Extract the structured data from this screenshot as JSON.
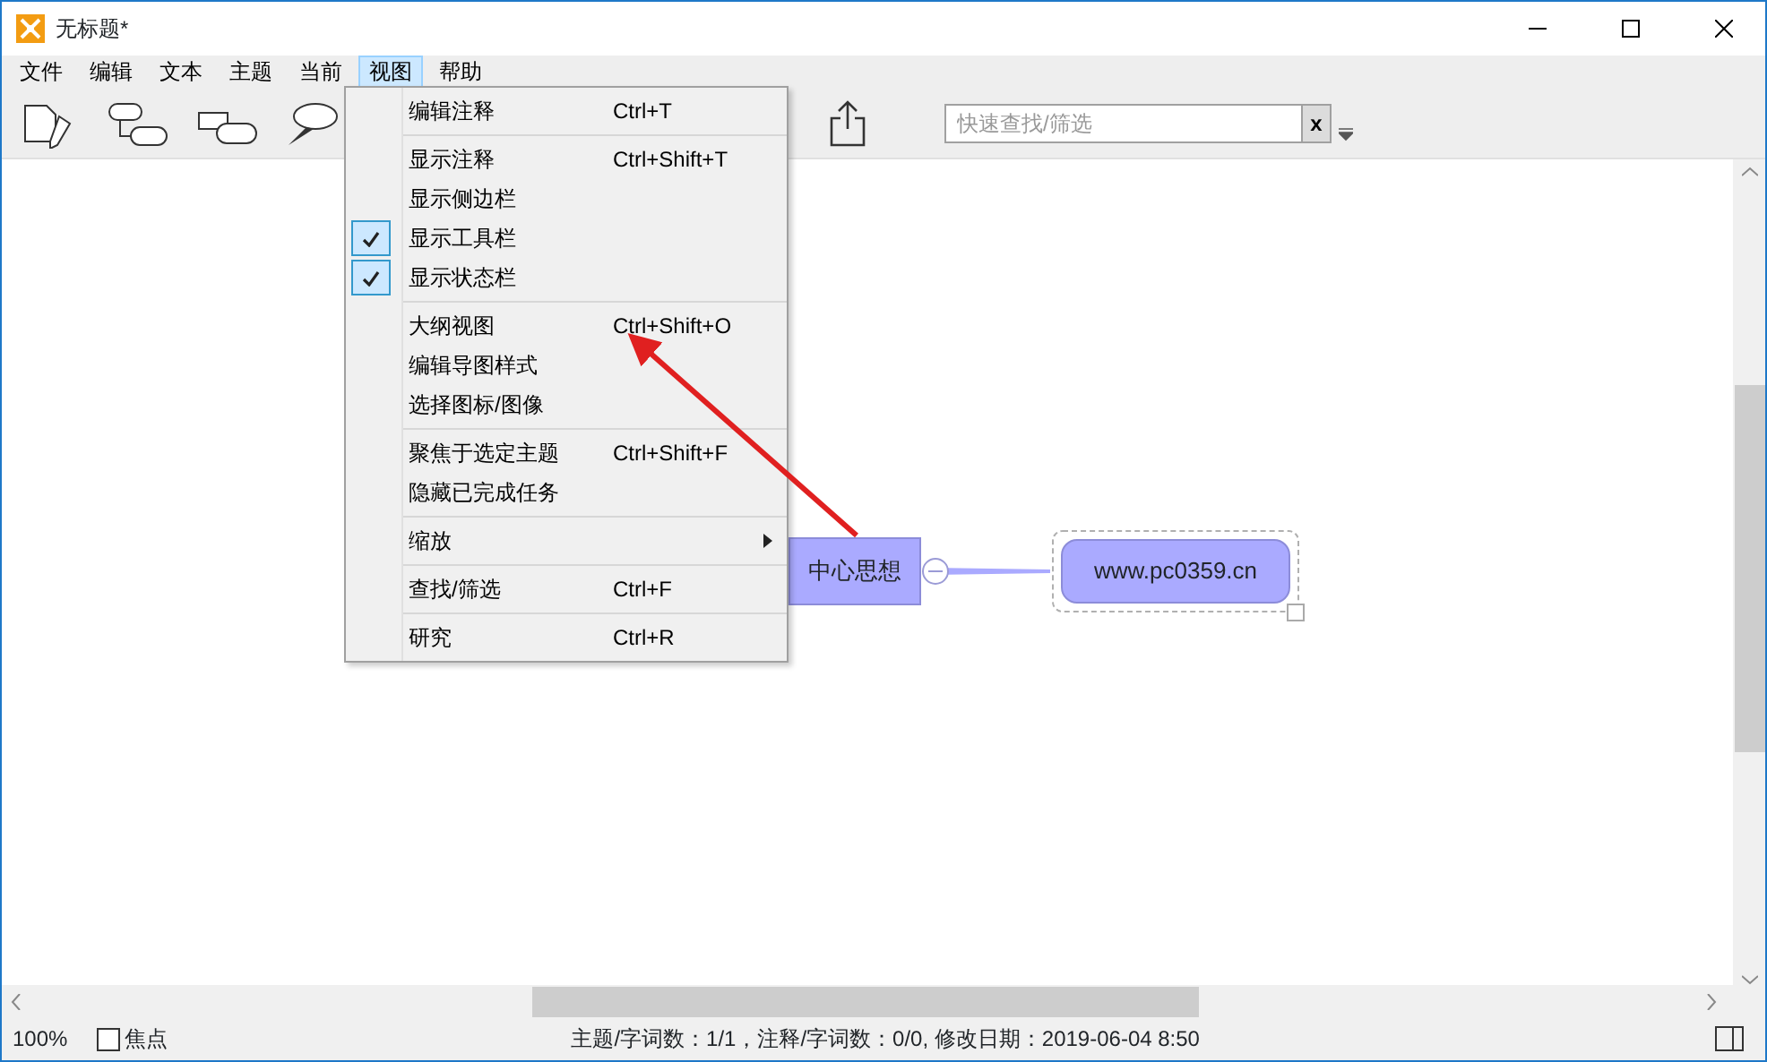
{
  "window": {
    "title": "无标题*"
  },
  "menubar": [
    {
      "label": "文件",
      "selected": false
    },
    {
      "label": "编辑",
      "selected": false
    },
    {
      "label": "文本",
      "selected": false
    },
    {
      "label": "主题",
      "selected": false
    },
    {
      "label": "当前",
      "selected": false
    },
    {
      "label": "视图",
      "selected": true
    },
    {
      "label": "帮助",
      "selected": false
    }
  ],
  "view_menu": [
    {
      "kind": "item",
      "label": "编辑注释",
      "shortcut": "Ctrl+T",
      "checked": false
    },
    {
      "kind": "separator"
    },
    {
      "kind": "item",
      "label": "显示注释",
      "shortcut": "Ctrl+Shift+T",
      "checked": false
    },
    {
      "kind": "item",
      "label": "显示侧边栏",
      "checked": false
    },
    {
      "kind": "item",
      "label": "显示工具栏",
      "checked": true
    },
    {
      "kind": "item",
      "label": "显示状态栏",
      "checked": true
    },
    {
      "kind": "separator"
    },
    {
      "kind": "item",
      "label": "大纲视图",
      "shortcut": "Ctrl+Shift+O",
      "checked": false
    },
    {
      "kind": "item",
      "label": "编辑导图样式",
      "checked": false
    },
    {
      "kind": "item",
      "label": "选择图标/图像",
      "checked": false
    },
    {
      "kind": "separator"
    },
    {
      "kind": "item",
      "label": "聚焦于选定主题",
      "shortcut": "Ctrl+Shift+F",
      "checked": false
    },
    {
      "kind": "item",
      "label": "隐藏已完成任务",
      "checked": false
    },
    {
      "kind": "separator"
    },
    {
      "kind": "item",
      "label": "缩放",
      "checked": false,
      "submenu": true
    },
    {
      "kind": "separator"
    },
    {
      "kind": "item",
      "label": "查找/筛选",
      "shortcut": "Ctrl+F",
      "checked": false
    },
    {
      "kind": "separator"
    },
    {
      "kind": "item",
      "label": "研究",
      "shortcut": "Ctrl+R",
      "checked": false
    }
  ],
  "search": {
    "placeholder": "快速查找/筛选",
    "clear": "x"
  },
  "map": {
    "central": "中心思想",
    "child": "www.pc0359.cn"
  },
  "status_bar": {
    "zoom": "100%",
    "focus": {
      "label": "焦点",
      "checked": false
    },
    "info": "主题/字词数：1/1，注释/字词数：0/0, 修改日期：2019-06-04 8:50"
  }
}
